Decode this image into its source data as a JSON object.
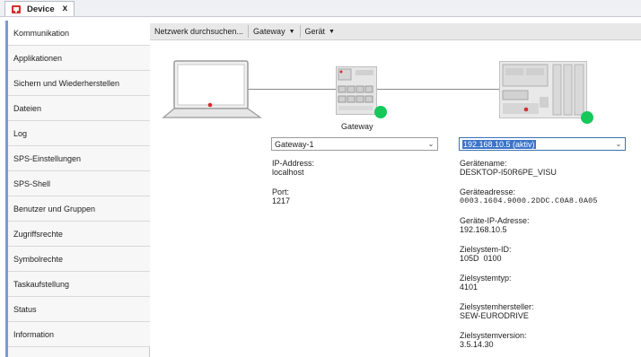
{
  "tab": {
    "label": "Device",
    "close": "x",
    "icon": "device-icon"
  },
  "sidebar": {
    "items": [
      {
        "label": "Kommunikation"
      },
      {
        "label": "Applikationen"
      },
      {
        "label": "Sichern und Wiederherstellen"
      },
      {
        "label": "Dateien"
      },
      {
        "label": "Log"
      },
      {
        "label": "SPS-Einstellungen"
      },
      {
        "label": "SPS-Shell"
      },
      {
        "label": "Benutzer und Gruppen"
      },
      {
        "label": "Zugriffsrechte"
      },
      {
        "label": "Symbolrechte"
      },
      {
        "label": "Taskaufstellung"
      },
      {
        "label": "Status"
      },
      {
        "label": "Information"
      }
    ]
  },
  "toolbar": {
    "scan": "Netzwerk durchsuchen...",
    "gateway": "Gateway",
    "device": "Gerät"
  },
  "diagram": {
    "gateway_caption": "Gateway",
    "status_color": "#16c85a"
  },
  "gateway": {
    "selected": "Gateway-1",
    "ip_label": "IP-Address:",
    "ip_value": "localhost",
    "port_label": "Port:",
    "port_value": "1217"
  },
  "device": {
    "selected": "192.168.10.5 (aktiv)",
    "fields": [
      {
        "label": "Gerätename:",
        "value": "DESKTOP-I50R6PE_VISU"
      },
      {
        "label": "Geräteadresse:",
        "value": "0003.1604.9000.2DDC.C0A8.0A05"
      },
      {
        "label": "Geräte-IP-Adresse:",
        "value": "192.168.10.5"
      },
      {
        "label": "Zielsystem-ID:",
        "value": "105D  0100"
      },
      {
        "label": "Zielsystemtyp:",
        "value": "4101"
      },
      {
        "label": "Zielsystemhersteller:",
        "value": "SEW-EURODRIVE"
      },
      {
        "label": "Zielsystemversion:",
        "value": "3.5.14.30"
      }
    ]
  }
}
